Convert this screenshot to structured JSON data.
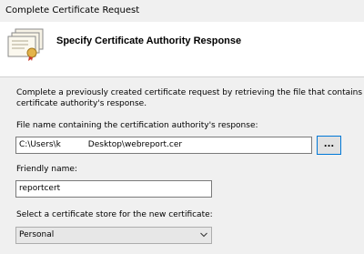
{
  "window": {
    "title": "Complete Certificate Request"
  },
  "header": {
    "title": "Specify Certificate Authority Response",
    "icon": "certificate-icon"
  },
  "description": "Complete a previously created certificate request by retrieving the file that contains the certificate authority's response.",
  "file": {
    "label": "File name containing the certification authority's response:",
    "value_prefix": "C:\\Users\\k",
    "value_suffix": "Desktop\\webreport.cer",
    "browse_label": "..."
  },
  "friendly": {
    "label": "Friendly name:",
    "value": "reportcert"
  },
  "store": {
    "label": "Select a certificate store for the new certificate:",
    "selected": "Personal"
  },
  "colors": {
    "accent": "#0078d7",
    "header_bg": "#ffffff",
    "body_bg": "#f0f0f0"
  }
}
